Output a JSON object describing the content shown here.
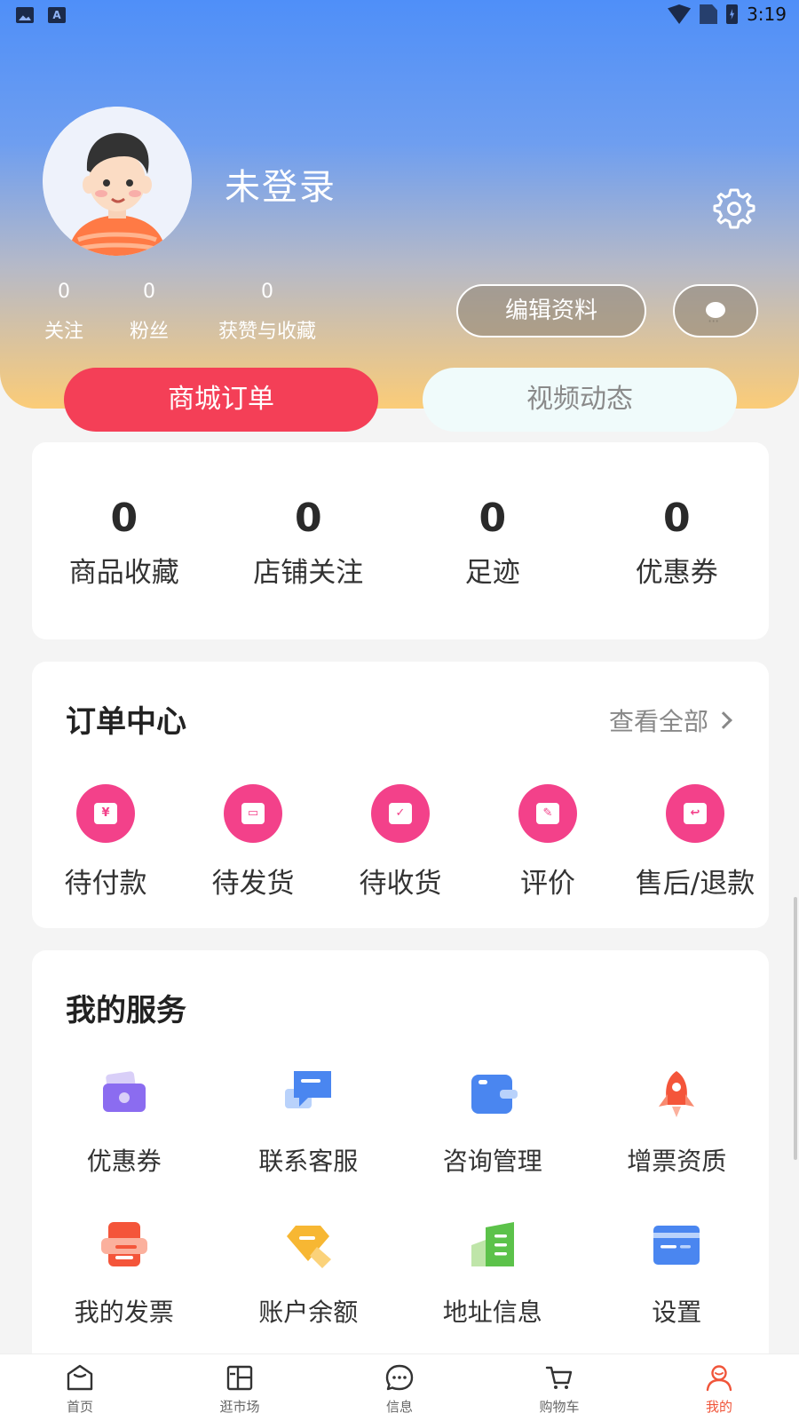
{
  "status_bar": {
    "time": "3:19"
  },
  "profile": {
    "username": "未登录",
    "stats": [
      {
        "value": "0",
        "label": "关注"
      },
      {
        "value": "0",
        "label": "粉丝"
      },
      {
        "value": "0",
        "label": "获赞与收藏"
      }
    ],
    "edit_label": "编辑资料"
  },
  "tabs": {
    "active": "商城订单",
    "inactive": "视频动态"
  },
  "summary": [
    {
      "value": "0",
      "label": "商品收藏"
    },
    {
      "value": "0",
      "label": "店铺关注"
    },
    {
      "value": "0",
      "label": "足迹"
    },
    {
      "value": "0",
      "label": "优惠券"
    }
  ],
  "orders": {
    "title": "订单中心",
    "view_all": "查看全部",
    "items": [
      {
        "label": "待付款",
        "icon": "pending-payment-icon"
      },
      {
        "label": "待发货",
        "icon": "pending-shipment-icon"
      },
      {
        "label": "待收货",
        "icon": "pending-receipt-icon"
      },
      {
        "label": "评价",
        "icon": "review-icon"
      },
      {
        "label": "售后/退款",
        "icon": "refund-icon"
      }
    ]
  },
  "services": {
    "title": "我的服务",
    "items": [
      {
        "label": "优惠券",
        "icon": "coupon-wallet-icon"
      },
      {
        "label": "联系客服",
        "icon": "chat-service-icon"
      },
      {
        "label": "咨询管理",
        "icon": "consult-icon"
      },
      {
        "label": "增票资质",
        "icon": "rocket-icon"
      },
      {
        "label": "我的发票",
        "icon": "invoice-icon"
      },
      {
        "label": "账户余额",
        "icon": "balance-tag-icon"
      },
      {
        "label": "地址信息",
        "icon": "address-building-icon"
      },
      {
        "label": "设置",
        "icon": "settings-card-icon"
      }
    ]
  },
  "bottom_nav": [
    {
      "label": "首页",
      "icon": "home-icon",
      "active": false
    },
    {
      "label": "逛市场",
      "icon": "market-icon",
      "active": false
    },
    {
      "label": "信息",
      "icon": "message-icon",
      "active": false
    },
    {
      "label": "购物车",
      "icon": "cart-icon",
      "active": false
    },
    {
      "label": "我的",
      "icon": "profile-icon",
      "active": true
    }
  ],
  "colors": {
    "accent_red": "#f43f57",
    "order_pink": "#f3418a",
    "active_nav": "#f0553a"
  }
}
